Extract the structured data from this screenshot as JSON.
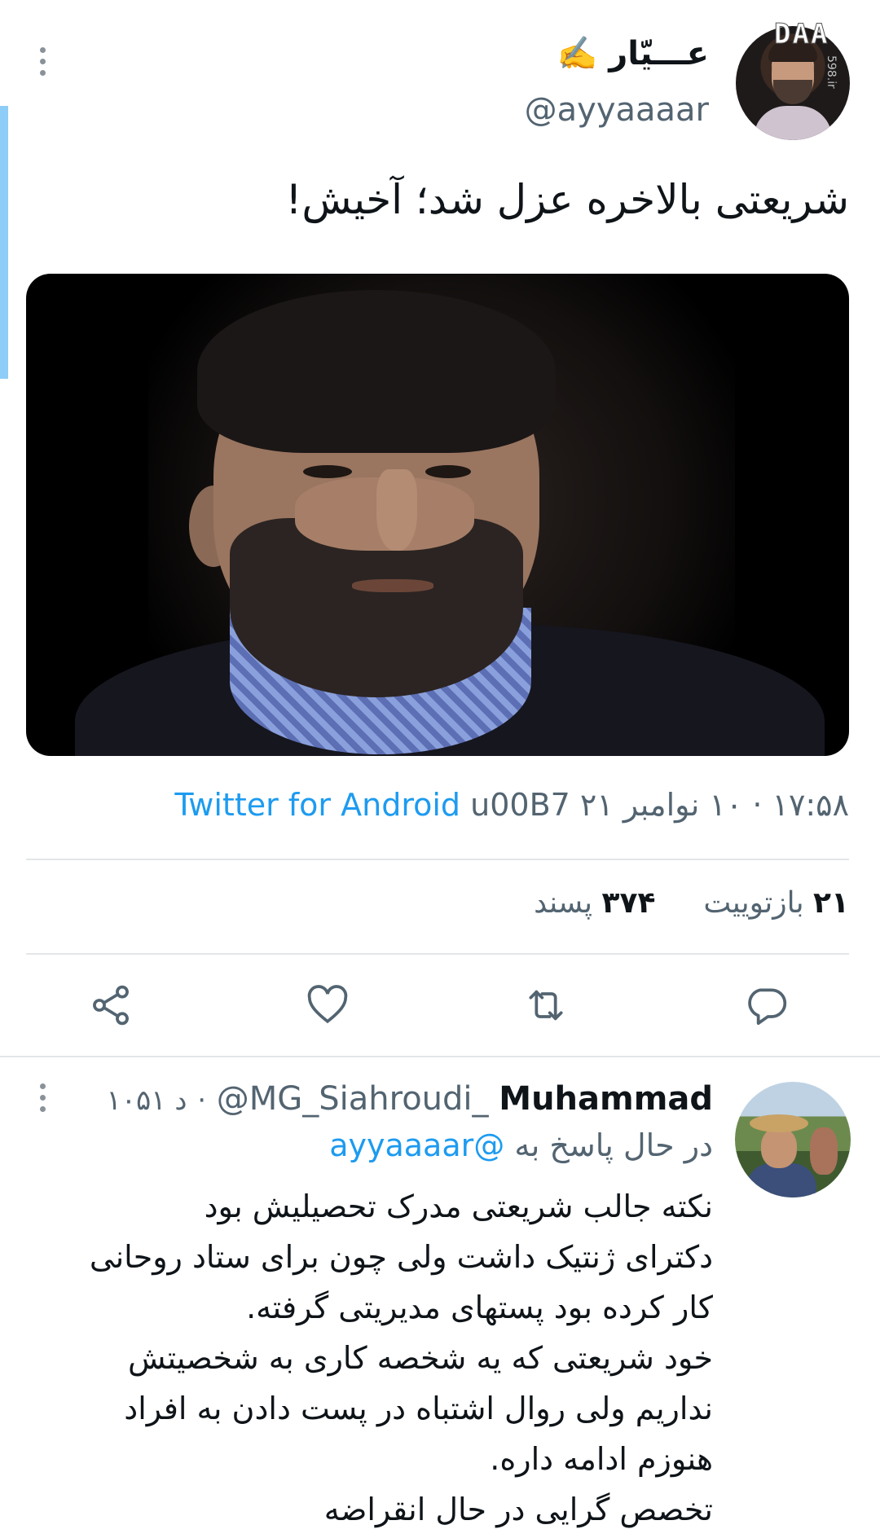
{
  "main_tweet": {
    "display_name": "عـــیّار ✍️",
    "handle": "@ayyaaaar",
    "text": "شریعتی بالاخره عزل شد؛ آخیش!",
    "timestamp": "۱۷:۵۸ · ۱۰ نوامبر ۲۱ u00B7",
    "source": "Twitter for Android",
    "retweets_count": "۲۱",
    "retweets_label": "بازتوییت",
    "likes_count": "۳۷۴",
    "likes_label": "پسند"
  },
  "watermark": {
    "text": "DAA",
    "sub": "598.ir"
  },
  "actions": [
    "reply-icon",
    "retweet-icon",
    "like-icon",
    "share-icon"
  ],
  "reply": {
    "name": "Muhammad",
    "handle": "@MG_Siahroudi_",
    "time": "۱۰۵۱ د",
    "replying_label": "در حال پاسخ به",
    "replying_to": "@ayyaaaar",
    "lines": [
      "نکته جالب شریعتی مدرک تحصیلیش بود",
      "دکترای ژنتیک داشت ولی چون برای ستاد روحانی",
      "کار کرده بود پستهای مدیریتی گرفته.",
      "خود شریعتی که یه شخصه کاری به شخصیتش",
      "نداریم ولی روال اشتباه در پست دادن به افراد",
      "هنوزم ادامه داره.",
      "تخصص گرایی در حال انقراضه"
    ]
  },
  "colors": {
    "link": "#1d9bf0",
    "muted": "#536471",
    "divider": "#e3e6e8",
    "accent_bar": "#8ecdf7"
  }
}
